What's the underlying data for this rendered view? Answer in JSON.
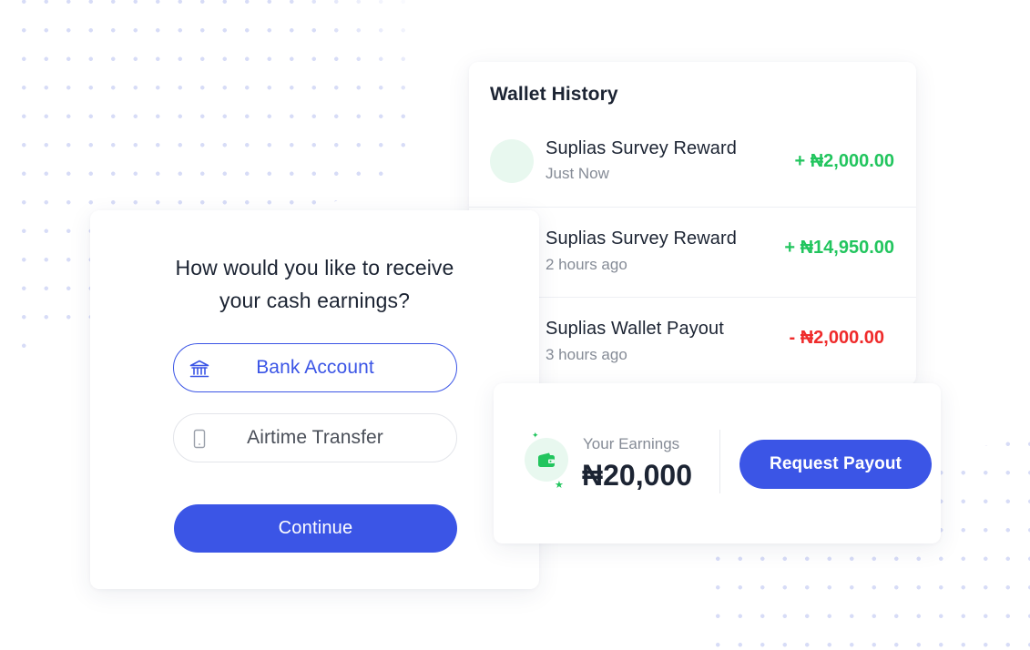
{
  "wallet_history": {
    "title": "Wallet History",
    "transactions": [
      {
        "name": "Suplias Survey Reward",
        "time": "Just Now",
        "amount": "+ ₦2,000.00",
        "type": "credit"
      },
      {
        "name": "Suplias Survey Reward",
        "time": "2 hours ago",
        "amount": "+ ₦14,950.00",
        "type": "credit"
      },
      {
        "name": "Suplias Wallet Payout",
        "time": "3 hours ago",
        "amount": "- ₦2,000.00",
        "type": "debit"
      }
    ]
  },
  "payment_method": {
    "question_line1": "How would you like to receive",
    "question_line2": "your cash earnings?",
    "options": [
      {
        "label": "Bank Account",
        "icon": "bank-icon",
        "selected": true
      },
      {
        "label": "Airtime Transfer",
        "icon": "phone-icon",
        "selected": false
      }
    ],
    "continue_label": "Continue"
  },
  "earnings": {
    "label": "Your Earnings",
    "value": "₦20,000",
    "icon": "wallet-icon",
    "payout_label": "Request Payout"
  },
  "colors": {
    "primary": "#3b55e6",
    "credit": "#22c55e",
    "debit": "#ef2b2b",
    "text": "#1c2433",
    "muted": "#858b96"
  }
}
